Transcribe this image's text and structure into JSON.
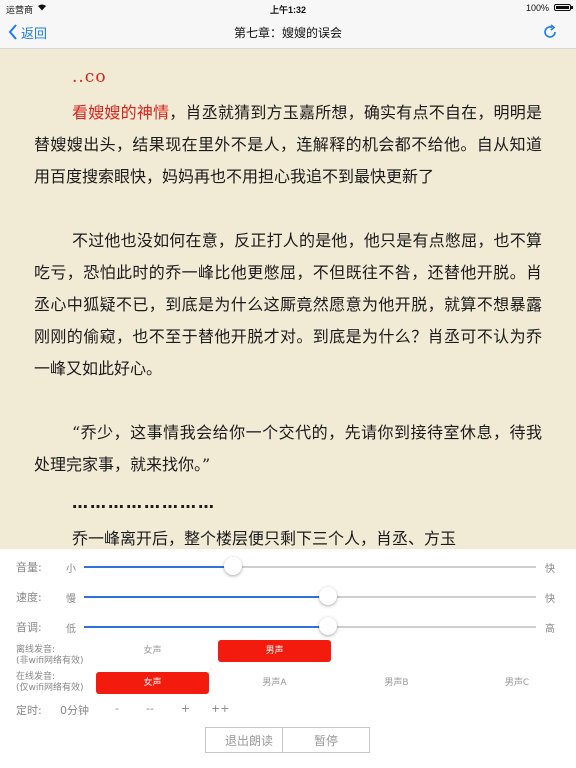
{
  "status_bar": {
    "carrier": "运营商",
    "time": "上午1:32",
    "battery": "100%"
  },
  "nav": {
    "back_label": "返回",
    "title": "第七章：嫂嫂的误会",
    "icons": {
      "back": "chevron-left-icon",
      "refresh": "refresh-icon"
    },
    "accent_color": "#1a7cf4"
  },
  "reader": {
    "url_line": "..co",
    "paragraph_1_highlight": "看嫂嫂的神情",
    "paragraph_1_rest": "，肖丞就猜到方玉嘉所想，确实有点不自在，明明是替嫂嫂出头，结果现在里外不是人，连解释的机会都不给他。自从知道用百度搜索眼快，妈妈再也不用担心我追不到最快更新了",
    "paragraph_2": "不过他也没如何在意，反正打人的是他，他只是有点憋屈，也不算吃亏，恐怕此时的乔一峰比他更憋屈，不但既往不咎，还替他开脱。肖丞心中狐疑不已，到底是为什么这厮竟然愿意为他开脱，就算不想暴露刚刚的偷窥，也不至于替他开脱才对。到底是为什么？肖丞可不认为乔一峰又如此好心。",
    "paragraph_3": "“乔少，这事情我会给你一个交代的，先请你到接待室休息，待我处理完家事，就来找你。”",
    "dots": "……………………",
    "paragraph_4": "乔一峰离开后，整个楼层便只剩下三个人，肖丞、方玉",
    "highlight_color": "#d9241c"
  },
  "controls": {
    "volume": {
      "label": "音量:",
      "min": "小",
      "max": "快",
      "value_fraction": 0.33
    },
    "speed": {
      "label": "速度:",
      "min": "慢",
      "max": "快",
      "value_fraction": 0.54
    },
    "pitch": {
      "label": "音调:",
      "min": "低",
      "max": "高",
      "value_fraction": 0.54
    },
    "offline": {
      "label_1": "离线发音:",
      "label_2": "(非wifi网络有效)",
      "options": [
        "女声",
        "男声"
      ],
      "selected": "男声"
    },
    "online": {
      "label_1": "在线发音:",
      "label_2": "(仅wifi网络有效)",
      "options": [
        "女声",
        "男声A",
        "男声B",
        "男声C"
      ],
      "selected": "女声"
    },
    "timer": {
      "label": "定时:",
      "value": "0分钟",
      "buttons": [
        "-",
        "--",
        "+",
        "++"
      ]
    },
    "exit_label": "退出朗读",
    "pause_label": "暂停",
    "selected_color": "#f21b0d",
    "slider_color": "#2d73d9"
  }
}
